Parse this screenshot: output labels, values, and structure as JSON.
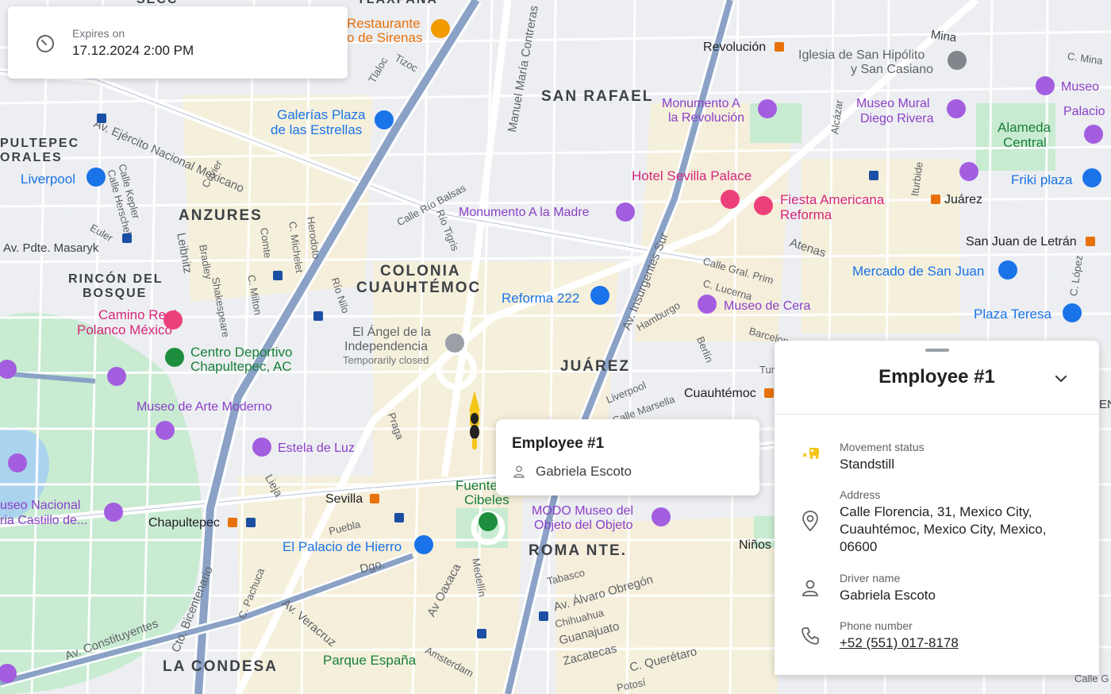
{
  "expiry": {
    "label": "Expires on",
    "value": "17.12.2024 2:00 PM",
    "icon": "timer-icon"
  },
  "marker": {
    "tooltip_title": "Employee #1",
    "tooltip_driver": "Gabriela Escoto",
    "icon": "scooter-icon"
  },
  "panel": {
    "title": "Employee #1",
    "movement_status_label": "Movement status",
    "movement_status_value": "Standstill",
    "address_label": "Address",
    "address_line1": "Calle Florencia, 31, Mexico City,",
    "address_line2": "Cuauhtémoc, Mexico City, Mexico,",
    "address_line3": "06600",
    "driver_label": "Driver name",
    "driver_value": "Gabriela Escoto",
    "phone_label": "Phone number",
    "phone_value": "+52 (551) 017-8178",
    "accent_color": "#f5c518"
  },
  "map": {
    "districts": [
      "SAN RAFAEL",
      "ANZURES",
      "COLONIA",
      "CUAUHTÉMOC",
      "RINCÓN DEL",
      "BOSQUE",
      "JUÁREZ",
      "ROMA NTE.",
      "LA CONDESA",
      "PULTEPEC",
      "ORALES",
      "SECC"
    ],
    "pois_purple": [
      "Monumento A",
      "la Revolución",
      "Museo Mural",
      "Diego Rivera",
      "Museo",
      "Palacio",
      "Monumento A la Madre",
      "Museo de Cera",
      "Museo de Arte Moderno",
      "Estela de Luz",
      "MODO Museo del",
      "Objeto del Objeto",
      "useo Nacional",
      "ria Castillo de..."
    ],
    "pois_blue": [
      "Galerías Plaza",
      "de las Estrellas",
      "Liverpool",
      "Reforma 222",
      "Mercado de San Juan",
      "Plaza Teresa",
      "El Palacio de Hierro",
      "Friki plaza"
    ],
    "pois_pink": [
      "Hotel Sevilla Palace",
      "Fiesta Americana",
      "Reforma",
      "Camino Real",
      "Polanco México"
    ],
    "pois_green": [
      "Centro Deportivo",
      "Chapultepec, AC",
      "Parque España",
      "Fuente",
      "Cibeles",
      "Alameda",
      "Central"
    ],
    "pois_orange": [
      "Restaurante",
      "o de Sirenas"
    ],
    "poi_angel_1": "El Ángel de la",
    "poi_angel_2": "Independencia",
    "poi_angel_3": "Temporarily closed",
    "church_1": "Iglesia de San Hipólito",
    "church_2": "y San Casiano",
    "metro": [
      "Revolución",
      "Juárez",
      "San Juan de Letrán",
      "Cuauhtémoc",
      "Sevilla",
      "Chapultepec",
      "Niños"
    ],
    "streets": [
      "Av. Ejército Nacional Mexicano",
      "Av. Pdte. Masaryk",
      "Calle Kepler",
      "Calle Herschel",
      "Leibnitz",
      "Bradley",
      "Shakespeare",
      "C. Milton",
      "Herodoto",
      "C. Michelet",
      "Cuvier",
      "Euler",
      "Calle Río Balsas",
      "Río Tigris",
      "Río Nilo",
      "Manuel María Contreras",
      "Av. Insurgentes Sur",
      "Hamburgo",
      "Berlín",
      "Liverpool",
      "Calle Marsella",
      "Atenas",
      "Calle Gral. Prim",
      "C. Lucerna",
      "Barcelona",
      "Iturbide",
      "Alcázar",
      "C. López",
      "Mina",
      "C. Mina",
      "Praga",
      "Lieja",
      "Puebla",
      "Dgo.",
      "Av Oaxaca",
      "Medellín",
      "Tabasco",
      "Av. Álvaro Obregón",
      "Chihuahua",
      "Guanajuato",
      "Zacatecas",
      "C. Querétaro",
      "Potosí",
      "Amsterdam",
      "Av. Veracruz",
      "C. Pachuca",
      "Cto. Bicentenario",
      "Av. Constituyentes",
      "Tlaloc",
      "Tizoc",
      "Comte",
      "TLAXPANA",
      "Calle G",
      "Tur",
      "EN"
    ]
  }
}
